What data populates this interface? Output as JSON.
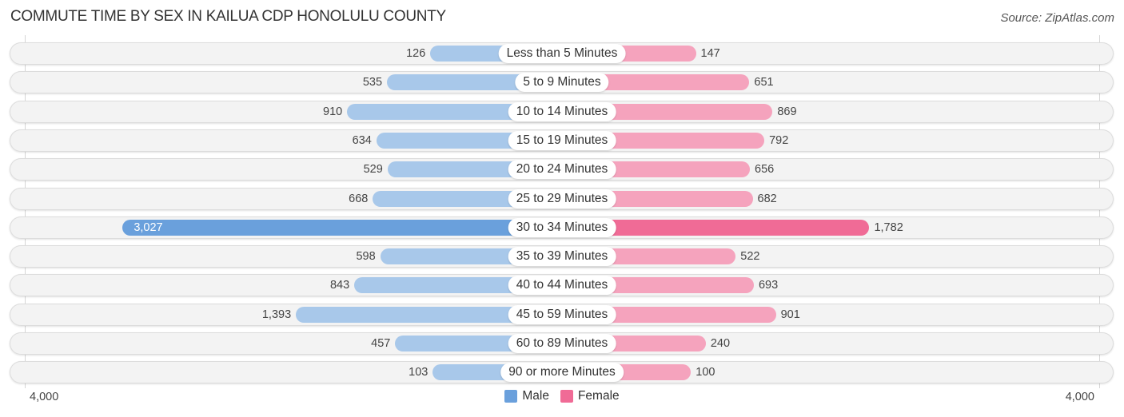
{
  "header": {
    "title": "COMMUTE TIME BY SEX IN KAILUA CDP HONOLULU COUNTY",
    "source": "Source: ZipAtlas.com"
  },
  "colors": {
    "male": "#6aa0dc",
    "male_light": "#a8c8ea",
    "female": "#f06b96",
    "female_light": "#f5a3bd"
  },
  "chart_data": {
    "type": "bar",
    "orientation": "horizontal-diverging",
    "title": "COMMUTE TIME BY SEX IN KAILUA CDP HONOLULU COUNTY",
    "categories": [
      "Less than 5 Minutes",
      "5 to 9 Minutes",
      "10 to 14 Minutes",
      "15 to 19 Minutes",
      "20 to 24 Minutes",
      "25 to 29 Minutes",
      "30 to 34 Minutes",
      "35 to 39 Minutes",
      "40 to 44 Minutes",
      "45 to 59 Minutes",
      "60 to 89 Minutes",
      "90 or more Minutes"
    ],
    "series": [
      {
        "name": "Male",
        "values": [
          126,
          535,
          910,
          634,
          529,
          668,
          3027,
          598,
          843,
          1393,
          457,
          103
        ],
        "labels": [
          "126",
          "535",
          "910",
          "634",
          "529",
          "668",
          "3,027",
          "598",
          "843",
          "1,393",
          "457",
          "103"
        ]
      },
      {
        "name": "Female",
        "values": [
          147,
          651,
          869,
          792,
          656,
          682,
          1782,
          522,
          693,
          901,
          240,
          100
        ],
        "labels": [
          "147",
          "651",
          "869",
          "792",
          "656",
          "682",
          "1,782",
          "522",
          "693",
          "901",
          "240",
          "100"
        ]
      }
    ],
    "xlim": [
      4000,
      4000
    ],
    "axis_labels": {
      "left": "4,000",
      "right": "4,000"
    },
    "legend": {
      "position": "bottom-center",
      "entries": [
        "Male",
        "Female"
      ]
    }
  }
}
